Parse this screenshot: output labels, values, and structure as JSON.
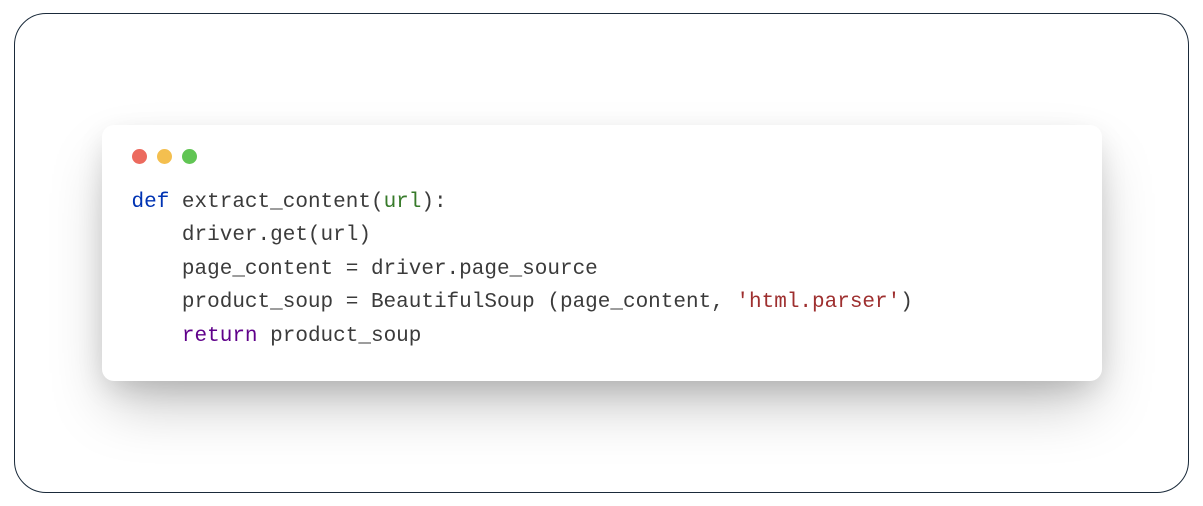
{
  "code": {
    "tokens": {
      "def": "def",
      "fn": "extract_content",
      "param": "url",
      "line2_indent": "    driver.get(url)",
      "line3_indent": "    page_content = driver.page_source",
      "line4_prefix": "    product_soup = BeautifulSoup (page_content, ",
      "line4_string": "'html.parser'",
      "line4_suffix": ")",
      "return": "return",
      "return_val": " product_soup"
    }
  }
}
